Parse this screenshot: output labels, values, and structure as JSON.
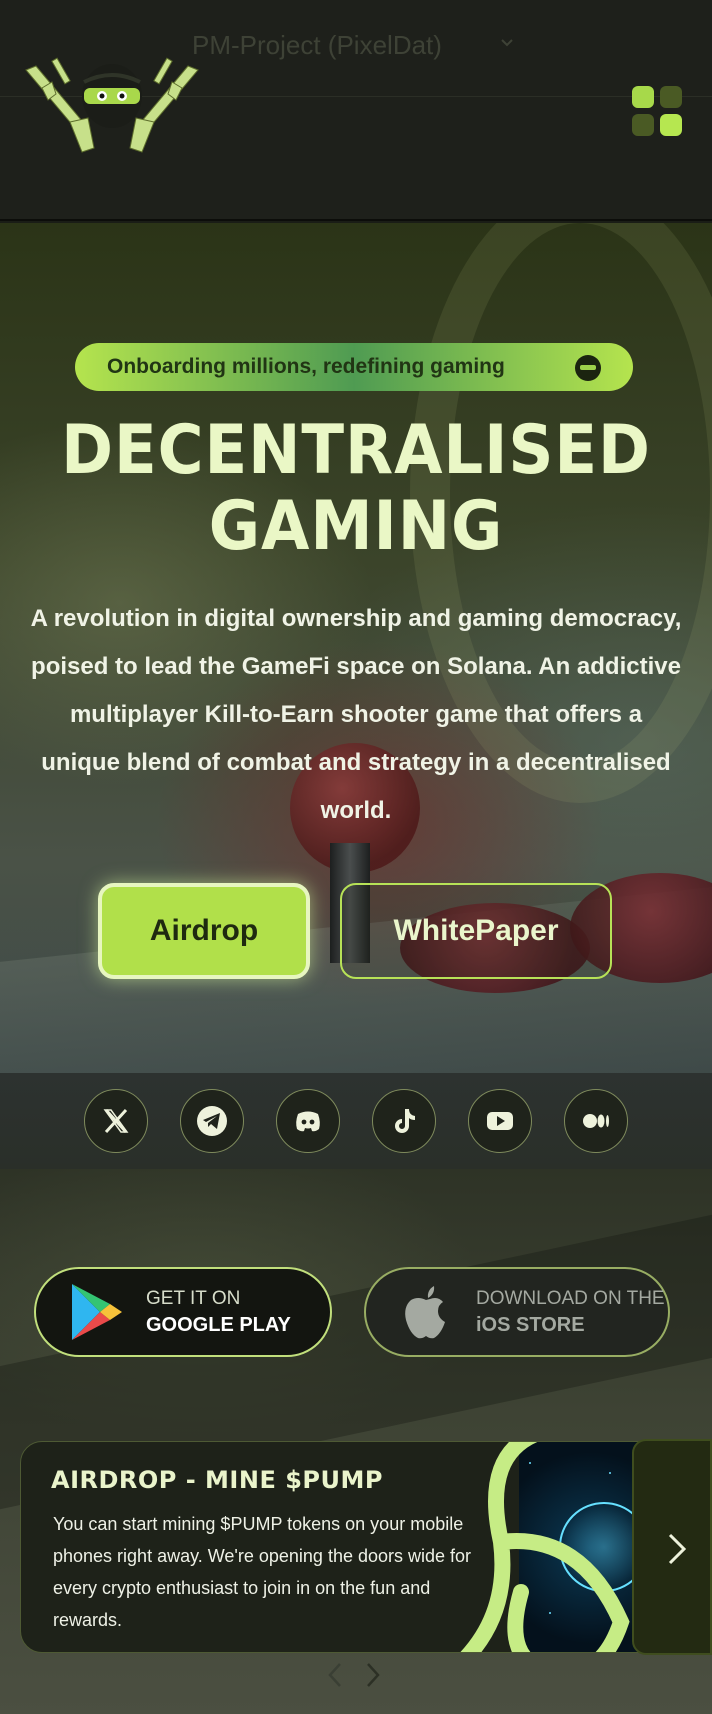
{
  "header": {
    "project_title": "PM-Project (PixelDat)",
    "logo_icon": "ninja-with-rifles-logo",
    "menu_icon": "grid-menu-icon"
  },
  "hero": {
    "tagline": "Onboarding millions, redefining gaming",
    "title_line1": "DECENTRALISED",
    "title_line2": "GAMING",
    "description": "A revolution in digital ownership and gaming democracy, poised to lead the GameFi space on Solana. An addictive multiplayer Kill-to-Earn shooter game that offers a unique blend of combat and strategy in a decentralised world.",
    "airdrop_label": "Airdrop",
    "whitepaper_label": "WhitePaper"
  },
  "social": {
    "items": [
      {
        "name": "x-icon"
      },
      {
        "name": "telegram-icon"
      },
      {
        "name": "discord-icon"
      },
      {
        "name": "tiktok-icon"
      },
      {
        "name": "youtube-icon"
      },
      {
        "name": "medium-icon"
      }
    ]
  },
  "stores": {
    "google_small": "GET IT ON",
    "google_big": "GOOGLE PLAY",
    "ios_small": "DOWNLOAD ON THE",
    "ios_big": "iOS STORE"
  },
  "card": {
    "title": "AIRDROP - MINE $PUMP",
    "text": "You can start mining $PUMP tokens on your mobile phones right away. We're opening the doors wide for every crypto enthusiast to join in on the fun and rewards."
  },
  "colors": {
    "accent": "#b1e04a",
    "background": "#1e201b"
  }
}
